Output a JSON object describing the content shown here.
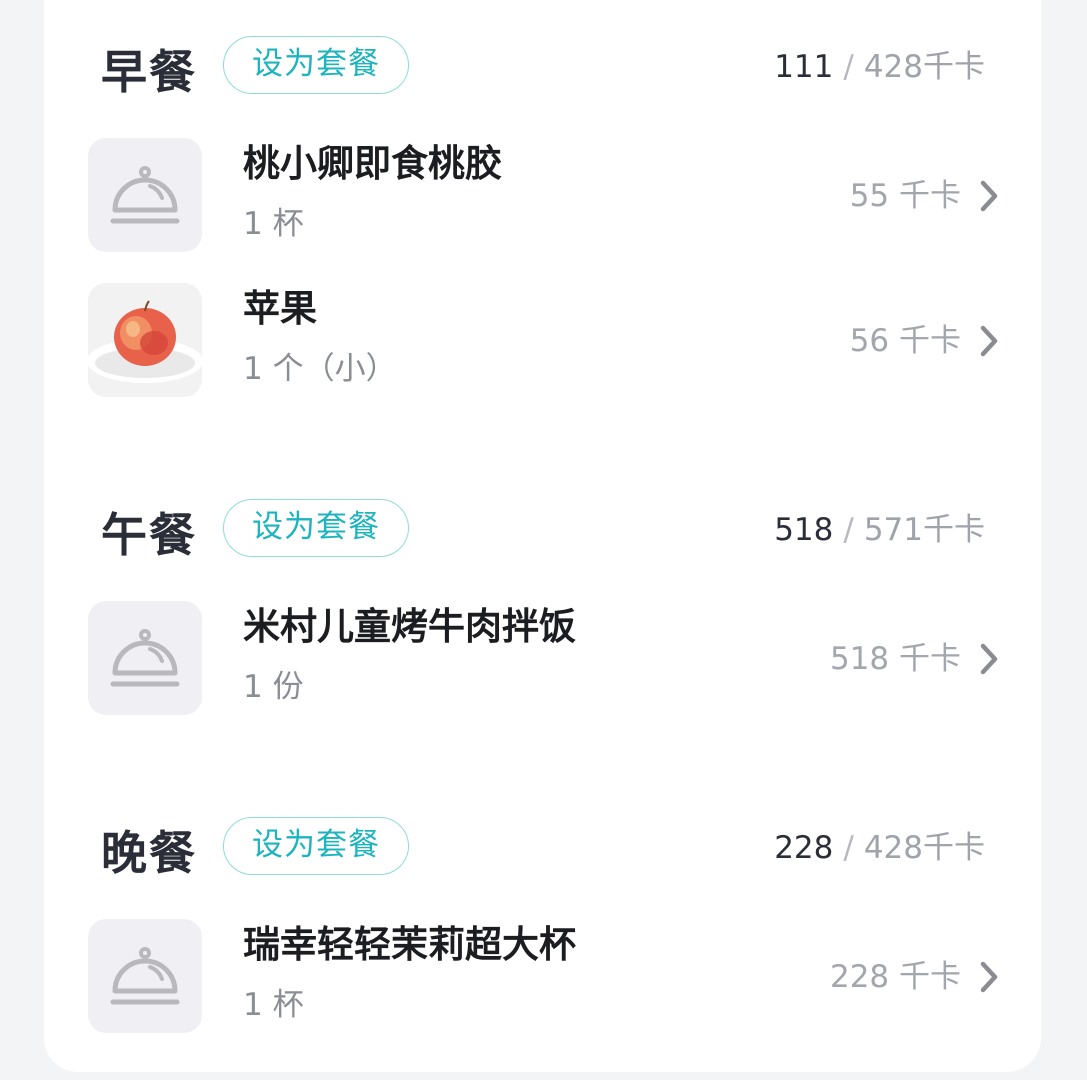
{
  "meals": [
    {
      "title": "早餐",
      "set_button": "设为套餐",
      "eaten": "111",
      "separator": "/",
      "budget": "428千卡",
      "items": [
        {
          "name": "桃小卿即食桃胶",
          "amount": "1 杯",
          "kcal": "55 千卡",
          "icon": "dish-cover-icon"
        },
        {
          "name": "苹果",
          "amount": "1 个（小）",
          "kcal": "56 千卡",
          "icon": "apple-photo"
        }
      ]
    },
    {
      "title": "午餐",
      "set_button": "设为套餐",
      "eaten": "518",
      "separator": "/",
      "budget": "571千卡",
      "items": [
        {
          "name": "米村儿童烤牛肉拌饭",
          "amount": "1 份",
          "kcal": "518 千卡",
          "icon": "dish-cover-icon"
        }
      ]
    },
    {
      "title": "晚餐",
      "set_button": "设为套餐",
      "eaten": "228",
      "separator": "/",
      "budget": "428千卡",
      "items": [
        {
          "name": "瑞幸轻轻茉莉超大杯",
          "amount": "1 杯",
          "kcal": "228 千卡",
          "icon": "dish-cover-icon"
        }
      ]
    }
  ],
  "colors": {
    "accent": "#1db4bd",
    "accent_border": "#8fdcda",
    "title": "#2b2e38",
    "muted": "#a0a3ab",
    "thumb_bg": "#f0f0f4"
  }
}
